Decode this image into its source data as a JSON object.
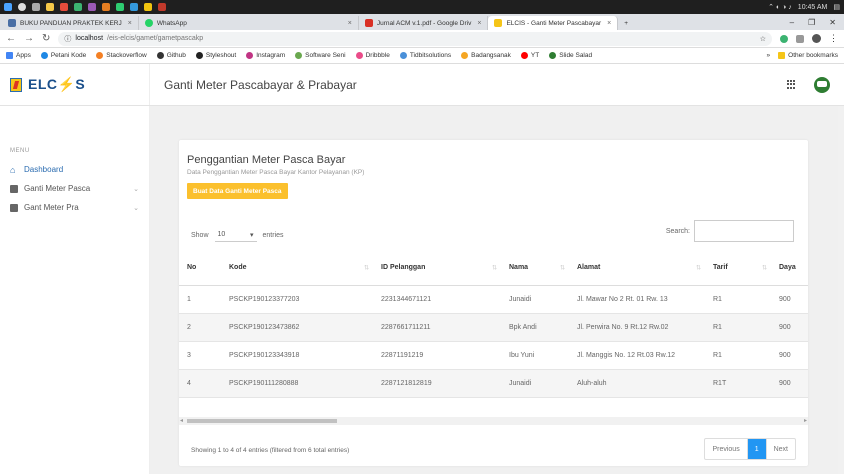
{
  "os": {
    "clock": "10:45 AM"
  },
  "browser": {
    "tabs": [
      {
        "label": "BUKU PANDUAN PRAKTEK KERJ",
        "active": false
      },
      {
        "label": "WhatsApp",
        "active": false
      },
      {
        "label": "Jurnal ACM v.1.pdf - Google Driv",
        "active": false
      },
      {
        "label": "ELCIS - Ganti Meter Pascabayar",
        "active": true
      }
    ],
    "url_host": "localhost",
    "url_path": "/eis-elcis/gamet/gametpascakp",
    "bookmarks": [
      "Apps",
      "Petani Kode",
      "Stackoverflow",
      "Github",
      "Styleshout",
      "Instagram",
      "Software Seni",
      "Dribbble",
      "Tidbitsolutions",
      "Badangsanak",
      "YT",
      "Slide Salad"
    ],
    "more": "»",
    "other_bookmarks": "Other bookmarks"
  },
  "header": {
    "logo": "ELC⚡S",
    "page_title": "Ganti Meter Pascabayar & Prabayar"
  },
  "sidebar": {
    "menu_label": "MENU",
    "items": [
      {
        "label": "Dashboard",
        "active": true
      },
      {
        "label": "Ganti Meter Pasca",
        "active": false
      },
      {
        "label": "Gant Meter Pra",
        "active": false
      }
    ]
  },
  "card": {
    "title": "Penggantian Meter Pasca Bayar",
    "subtitle": "Data Penggantian Meter Pasca Bayar Kantor Pelayanan (KP)",
    "add_button": "Buat Data Ganti Meter Pasca",
    "show_label": "Show",
    "show_value": "10",
    "entries_label": "entries",
    "search_label": "Search:",
    "columns": [
      "No",
      "Kode",
      "ID Pelanggan",
      "Nama",
      "Alamat",
      "Tarif",
      "Daya"
    ],
    "rows": [
      [
        "1",
        "PSCKP190123377203",
        "2231344671121",
        "Junaidi",
        "Jl. Mawar No 2 Rt. 01 Rw. 13",
        "R1",
        "900"
      ],
      [
        "2",
        "PSCKP190123473862",
        "2287661711211",
        "Bpk Andi",
        "Jl. Perwira No. 9 Rt.12 Rw.02",
        "R1",
        "900"
      ],
      [
        "3",
        "PSCKP190123343918",
        "22871191219",
        "Ibu Yuni",
        "Jl. Manggis No. 12 Rt.03 Rw.12",
        "R1",
        "900"
      ],
      [
        "4",
        "PSCKP190111280888",
        "2287121812819",
        "Junaidi",
        "Aluh-aluh",
        "R1T",
        "900"
      ]
    ],
    "info": "Showing 1 to 4 of 4 entries (filtered from 6 total entries)",
    "pager": {
      "prev": "Previous",
      "current": "1",
      "next": "Next"
    }
  },
  "colors": {
    "accent": "#2b6cb0",
    "button": "#fbc02d",
    "pager_active": "#2196f3"
  }
}
